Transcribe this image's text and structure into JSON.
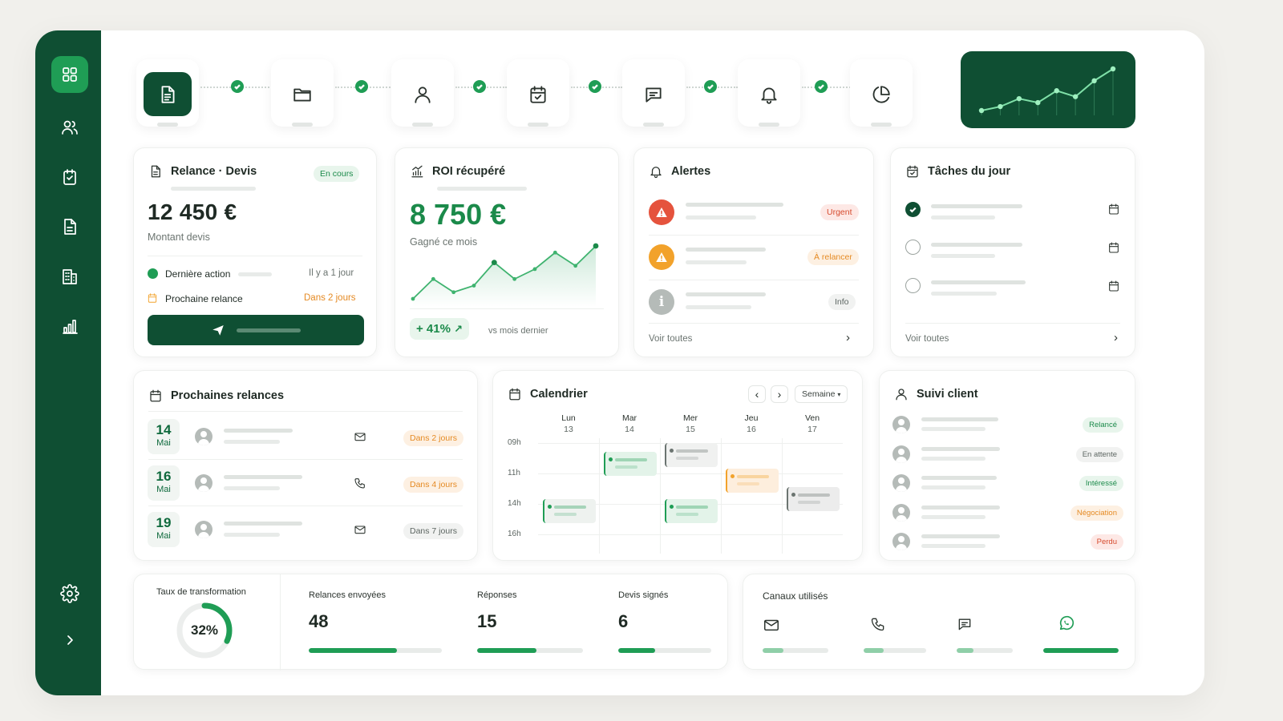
{
  "colors": {
    "brand": "#0f4f33",
    "accent": "#1f9d55",
    "urgent": "#e5533d",
    "warn": "#f2a22b"
  },
  "sidebar": {
    "items": [
      {
        "icon": "grid-icon",
        "active": true
      },
      {
        "icon": "users-icon"
      },
      {
        "icon": "clipboard-check-icon"
      },
      {
        "icon": "document-icon"
      },
      {
        "icon": "building-icon"
      },
      {
        "icon": "bar-chart-icon"
      }
    ],
    "bottom": [
      {
        "icon": "gear-icon"
      },
      {
        "icon": "chevron-right-icon"
      }
    ]
  },
  "stepper": {
    "steps": [
      {
        "icon": "document-icon",
        "active": true
      },
      {
        "icon": "folder-icon"
      },
      {
        "icon": "user-icon"
      },
      {
        "icon": "calendar-check-icon"
      },
      {
        "icon": "chat-icon"
      },
      {
        "icon": "bell-icon"
      },
      {
        "icon": "pie-chart-icon"
      }
    ]
  },
  "relance": {
    "title": "Relance · Devis",
    "status": "En cours",
    "amount": "12 450 €",
    "amount_label": "Montant devis",
    "last_action_label": "Dernière action",
    "last_action_value": "Il y a 1 jour",
    "next_label": "Prochaine relance",
    "next_value": "Dans 2 jours"
  },
  "roi": {
    "title": "ROI récupéré",
    "amount": "8 750 €",
    "subtitle": "Gagné ce mois",
    "growth": "+ 41%",
    "compare": "vs mois dernier",
    "trend": [
      10,
      22,
      14,
      18,
      32,
      22,
      28,
      38,
      30,
      42
    ]
  },
  "alertes": {
    "title": "Alertes",
    "items": [
      {
        "level": "Urgent"
      },
      {
        "level": "À relancer"
      },
      {
        "level": "Info"
      }
    ],
    "footer": "Voir toutes"
  },
  "taches": {
    "title": "Tâches du jour",
    "items": [
      {
        "done": true
      },
      {
        "done": false
      },
      {
        "done": false
      }
    ],
    "footer": "Voir toutes"
  },
  "prochaines": {
    "title": "Prochaines relances",
    "items": [
      {
        "day": "14",
        "month": "Mai",
        "channel": "mail-icon",
        "due": "Dans 2 jours"
      },
      {
        "day": "16",
        "month": "Mai",
        "channel": "phone-icon",
        "due": "Dans 4 jours"
      },
      {
        "day": "19",
        "month": "Mai",
        "channel": "mail-icon",
        "due": "Dans 7 jours"
      }
    ]
  },
  "calendrier": {
    "title": "Calendrier",
    "view": "Semaine",
    "days": [
      {
        "name": "Lun",
        "num": "13"
      },
      {
        "name": "Mar",
        "num": "14"
      },
      {
        "name": "Mer",
        "num": "15"
      },
      {
        "name": "Jeu",
        "num": "16"
      },
      {
        "name": "Ven",
        "num": "17"
      }
    ],
    "hours": [
      "09h",
      "11h",
      "14h",
      "16h"
    ]
  },
  "suivi": {
    "title": "Suivi client",
    "items": [
      {
        "status": "Relancé"
      },
      {
        "status": "En attente"
      },
      {
        "status": "Intéressé"
      },
      {
        "status": "Négociation"
      },
      {
        "status": "Perdu"
      }
    ]
  },
  "stats": {
    "conversion_label": "Taux de transformation",
    "conversion_value": "32%",
    "conversion_ratio": 0.32,
    "kpis": [
      {
        "label": "Relances envoyées",
        "value": "48",
        "fill": 0.66
      },
      {
        "label": "Réponses",
        "value": "15",
        "fill": 0.56
      },
      {
        "label": "Devis signés",
        "value": "6",
        "fill": 0.4
      }
    ]
  },
  "canaux": {
    "title": "Canaux utilisés",
    "items": [
      {
        "icon": "mail-icon",
        "fill": 0.32
      },
      {
        "icon": "phone-icon",
        "fill": 0.32
      },
      {
        "icon": "chat-icon",
        "fill": 0.3
      },
      {
        "icon": "whatsapp-icon",
        "fill": 1.0
      }
    ]
  }
}
